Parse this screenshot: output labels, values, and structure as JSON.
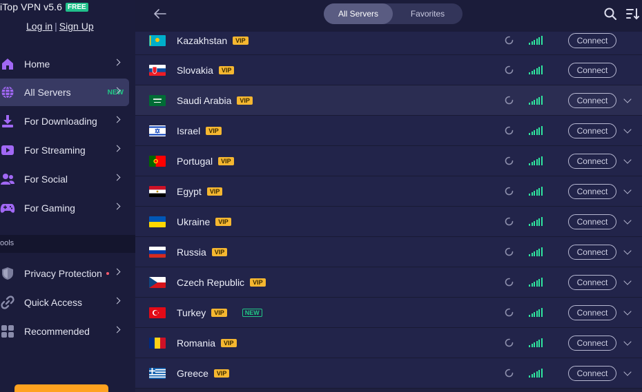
{
  "app": {
    "title": "iTop VPN v5.6",
    "free_badge": "FREE",
    "login": "Log in",
    "separator": "|",
    "signup": "Sign Up"
  },
  "sidebar": {
    "items": [
      {
        "label": "Home",
        "icon": "home-icon"
      },
      {
        "label": "All Servers",
        "icon": "globe-icon",
        "badge": "NEW",
        "active": true
      },
      {
        "label": "For Downloading",
        "icon": "download-icon"
      },
      {
        "label": "For Streaming",
        "icon": "play-icon"
      },
      {
        "label": "For Social",
        "icon": "users-icon"
      },
      {
        "label": "For Gaming",
        "icon": "gamepad-icon"
      }
    ],
    "tools_label": "ools",
    "tools": [
      {
        "label": "Privacy Protection",
        "icon": "shield-icon",
        "dot": true
      },
      {
        "label": "Quick Access",
        "icon": "link-icon"
      },
      {
        "label": "Recommended",
        "icon": "apps-icon"
      }
    ]
  },
  "header": {
    "tabs": [
      {
        "label": "All Servers",
        "active": true
      },
      {
        "label": "Favorites",
        "active": false
      }
    ]
  },
  "servers": [
    {
      "name": "Kazakhstan",
      "vip": "VIP",
      "connect": "Connect",
      "flag": "kz"
    },
    {
      "name": "Slovakia",
      "vip": "VIP",
      "connect": "Connect",
      "flag": "sk"
    },
    {
      "name": "Saudi Arabia",
      "vip": "VIP",
      "connect": "Connect",
      "flag": "sa"
    },
    {
      "name": "Israel",
      "vip": "VIP",
      "connect": "Connect",
      "flag": "il"
    },
    {
      "name": "Portugal",
      "vip": "VIP",
      "connect": "Connect",
      "flag": "pt"
    },
    {
      "name": "Egypt",
      "vip": "VIP",
      "connect": "Connect",
      "flag": "eg"
    },
    {
      "name": "Ukraine",
      "vip": "VIP",
      "connect": "Connect",
      "flag": "ua"
    },
    {
      "name": "Russia",
      "vip": "VIP",
      "connect": "Connect",
      "flag": "ru"
    },
    {
      "name": "Czech Republic",
      "vip": "VIP",
      "connect": "Connect",
      "flag": "cz"
    },
    {
      "name": "Turkey",
      "vip": "VIP",
      "new": "NEW",
      "connect": "Connect",
      "flag": "tr"
    },
    {
      "name": "Romania",
      "vip": "VIP",
      "connect": "Connect",
      "flag": "ro"
    },
    {
      "name": "Greece",
      "vip": "VIP",
      "connect": "Connect",
      "flag": "gr"
    }
  ],
  "colors": {
    "accent_green": "#21c986",
    "vip_gold": "#f5b730",
    "upgrade_orange": "#ffa21f"
  }
}
